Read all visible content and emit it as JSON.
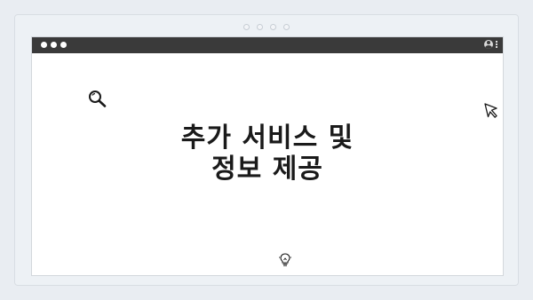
{
  "headline": {
    "line1": "추가 서비스 및",
    "line2": "정보 제공"
  },
  "icons": {
    "search": "search-icon",
    "cursor": "cursor-icon",
    "lightbulb": "lightbulb-icon",
    "user": "user-icon",
    "menu": "menu-icon"
  },
  "colors": {
    "titlebar": "#3a3a3a",
    "background": "#e9edf2",
    "window": "#ffffff",
    "text": "#1a1a1a"
  }
}
